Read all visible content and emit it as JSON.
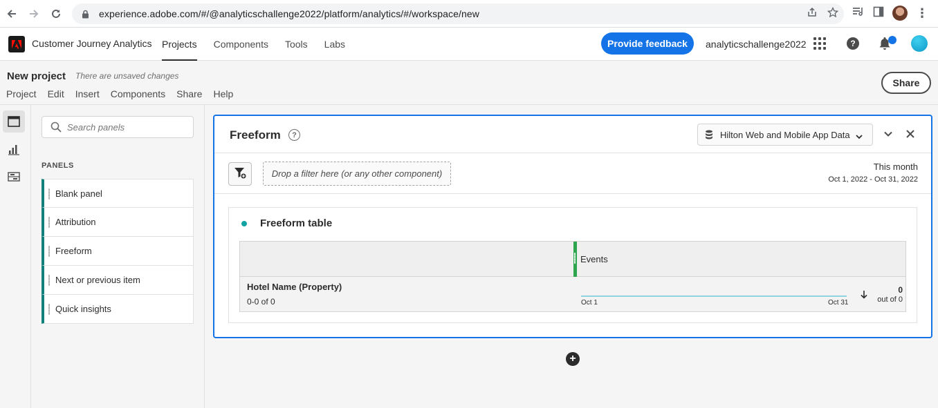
{
  "browser": {
    "url": "experience.adobe.com/#/@analyticschallenge2022/platform/analytics/#/workspace/new"
  },
  "header": {
    "app_title": "Customer Journey Analytics",
    "nav": [
      "Projects",
      "Components",
      "Tools",
      "Labs"
    ],
    "active_nav": "Projects",
    "feedback_label": "Provide feedback",
    "org_name": "analyticschallenge2022",
    "accent_color": "#1473e6"
  },
  "project": {
    "title": "New project",
    "status": "There are unsaved changes",
    "menu": [
      "Project",
      "Edit",
      "Insert",
      "Components",
      "Share",
      "Help"
    ],
    "share_label": "Share"
  },
  "rail": {
    "icons": [
      "panels-icon",
      "visualizations-icon",
      "components-icon"
    ]
  },
  "sidebar": {
    "search_placeholder": "Search panels",
    "heading": "PANELS",
    "items": [
      "Blank panel",
      "Attribution",
      "Freeform",
      "Next or previous item",
      "Quick insights"
    ],
    "item_accent": "#12807b"
  },
  "panel": {
    "title": "Freeform",
    "data_view": "Hilton Web and Mobile App Data",
    "filter_drop_text": "Drop a filter here (or any other component)",
    "date_preset": "This month",
    "date_range": "Oct 1, 2022 - Oct 31, 2022"
  },
  "table": {
    "title": "Freeform table",
    "metric": "Events",
    "dimension": "Hotel Name (Property)",
    "row_count": "0-0 of 0",
    "spark_start": "Oct 1",
    "spark_end": "Oct 31",
    "total": "0",
    "total_note": "out of 0"
  }
}
